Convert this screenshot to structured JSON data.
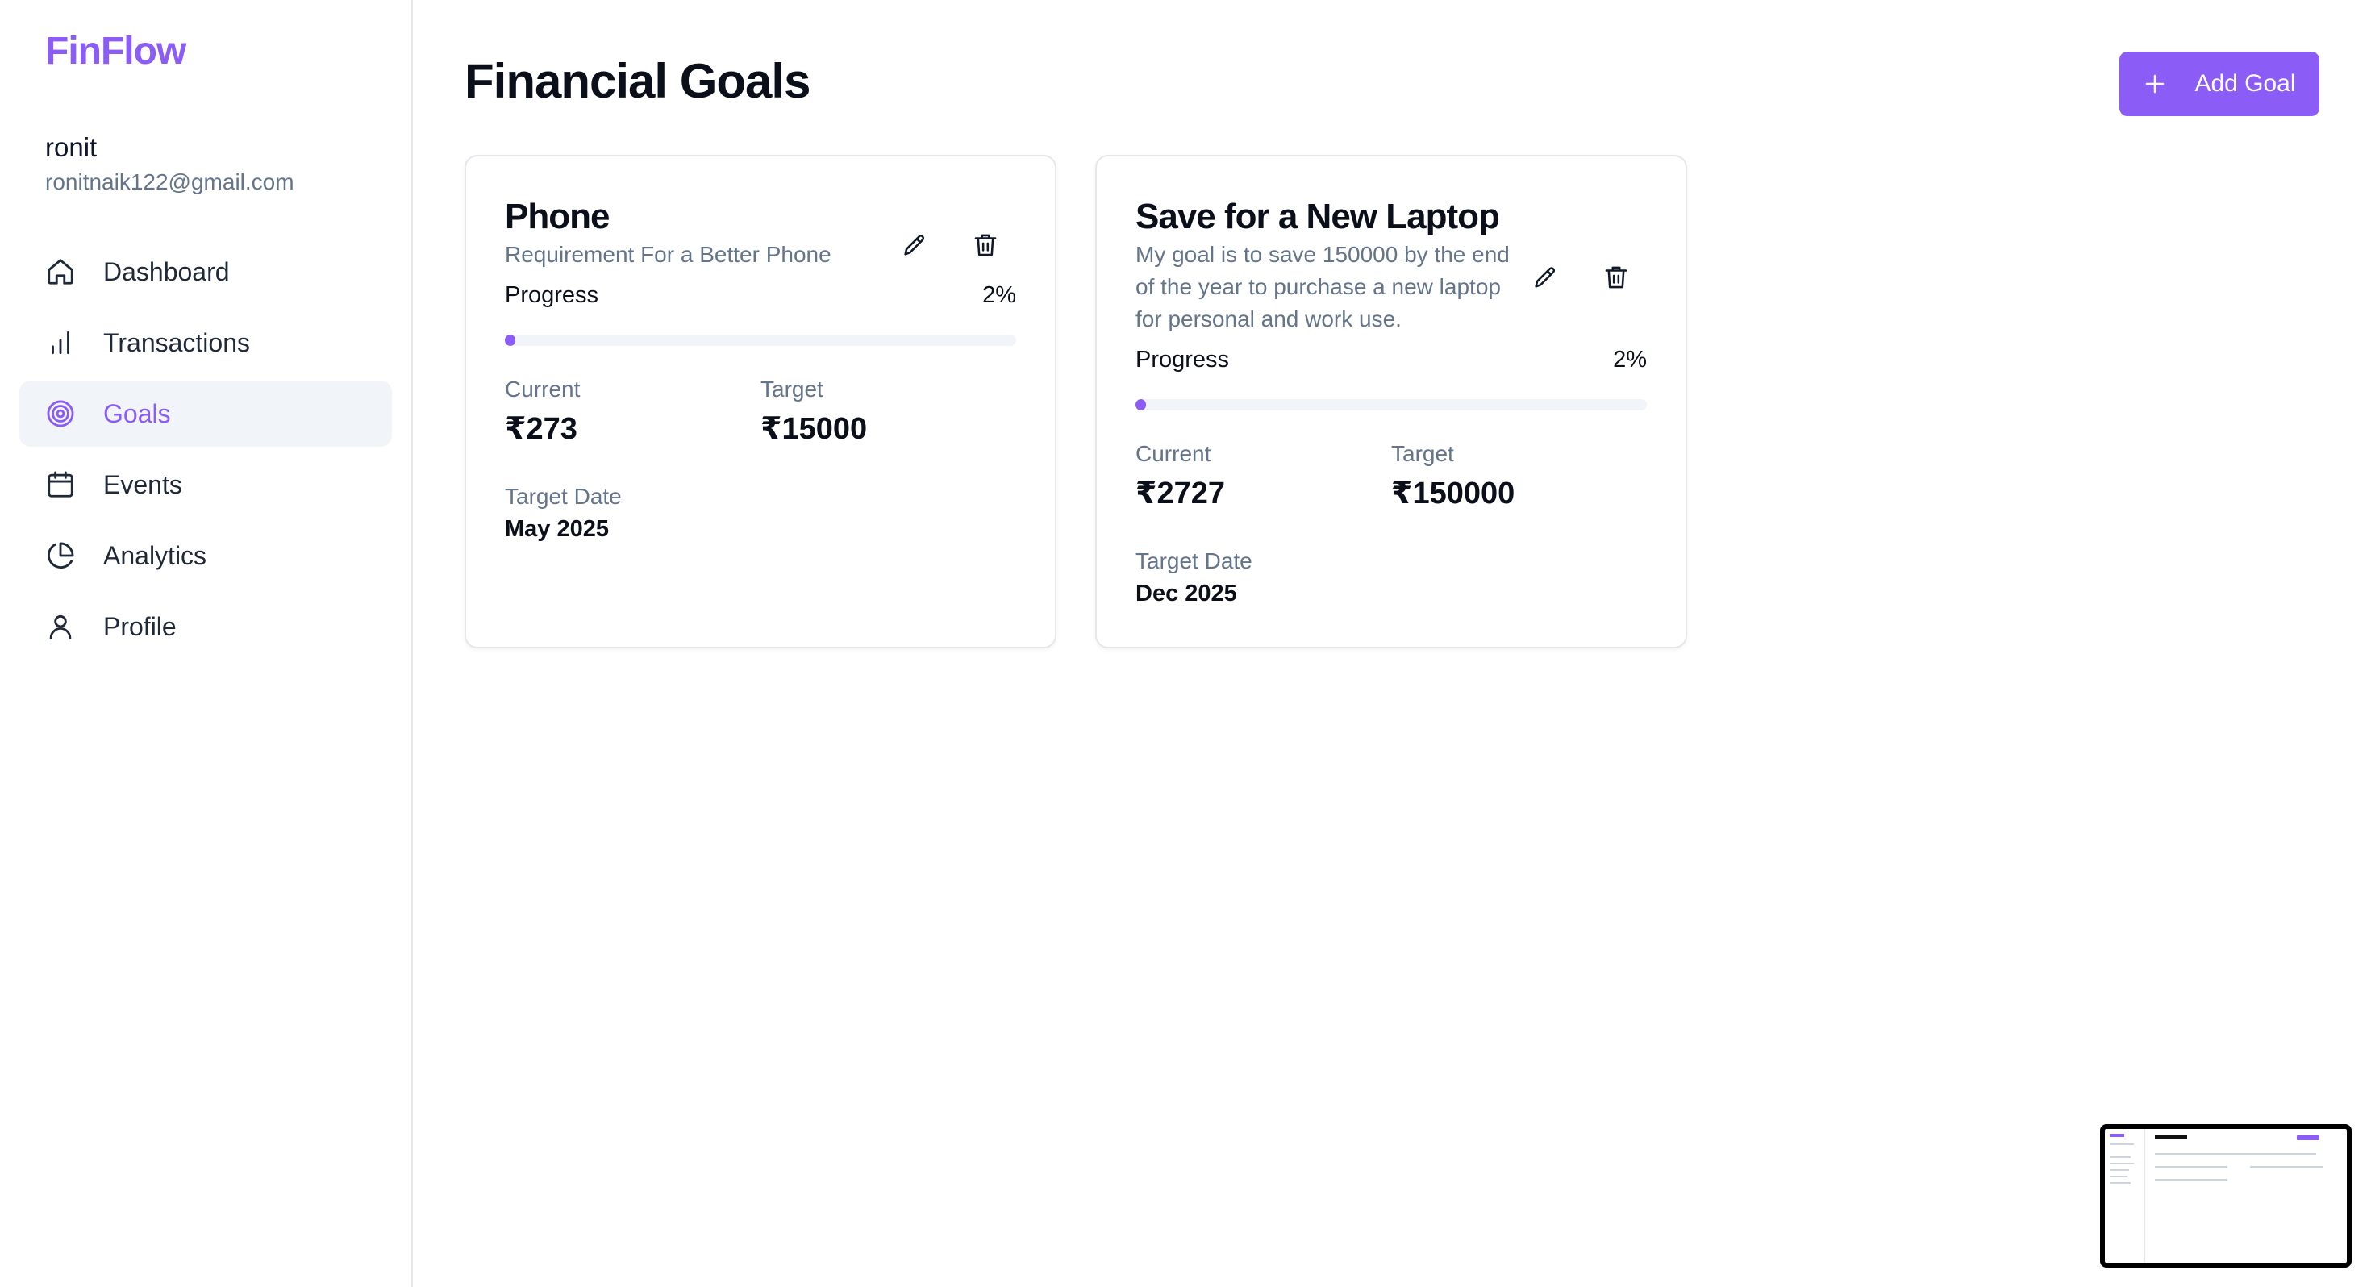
{
  "sidebar": {
    "brand": "FinFlow",
    "user": {
      "name": "ronit",
      "email": "ronitnaik122@gmail.com"
    },
    "nav": [
      {
        "label": "Dashboard",
        "icon": "home-icon",
        "active": false
      },
      {
        "label": "Transactions",
        "icon": "bar-chart-icon",
        "active": false
      },
      {
        "label": "Goals",
        "icon": "target-icon",
        "active": true
      },
      {
        "label": "Events",
        "icon": "calendar-icon",
        "active": false
      },
      {
        "label": "Analytics",
        "icon": "pie-chart-icon",
        "active": false
      },
      {
        "label": "Profile",
        "icon": "user-icon",
        "active": false
      }
    ]
  },
  "header": {
    "title": "Financial Goals",
    "add_button_label": "Add Goal",
    "add_button_icon": "plus-icon"
  },
  "colors": {
    "accent": "#8b5cf6",
    "muted": "#64748b",
    "track": "#f1f5f9"
  },
  "goals": [
    {
      "title": "Phone",
      "description": "Requirement For a Better Phone",
      "progress_label": "Progress",
      "progress_text": "2%",
      "progress_fraction": 0.02,
      "current_label": "Current",
      "current_value": "₹273",
      "target_label": "Target",
      "target_value": "₹15000",
      "date_label": "Target Date",
      "date_value": "May 2025",
      "edit_icon": "pencil-icon",
      "delete_icon": "trash-icon"
    },
    {
      "title": "Save for a New Laptop",
      "description": "My goal is to save 150000 by the end of the year to purchase a new laptop for personal and work use.",
      "progress_label": "Progress",
      "progress_text": "2%",
      "progress_fraction": 0.02,
      "current_label": "Current",
      "current_value": "₹2727",
      "target_label": "Target",
      "target_value": "₹150000",
      "date_label": "Target Date",
      "date_value": "Dec 2025",
      "edit_icon": "pencil-icon",
      "delete_icon": "trash-icon"
    }
  ]
}
